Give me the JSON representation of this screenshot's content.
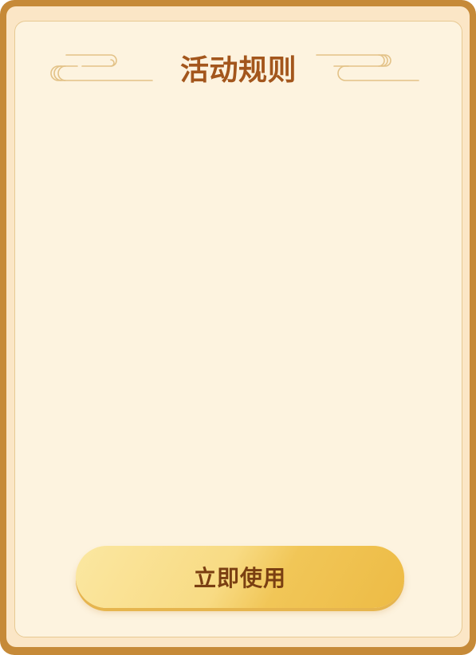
{
  "dialog": {
    "title": "活动规则",
    "rules_text": "",
    "primary_button_label": "立即使用"
  },
  "colors": {
    "frame": "#c68a38",
    "panel_background": "#fdf3df",
    "title": "#a3561c",
    "button_gradient_start": "#fbe7a1",
    "button_gradient_end": "#edbb45",
    "button_text": "#7a3f12"
  },
  "icons": {
    "left_decoration": "cloud-swirl-icon",
    "right_decoration": "cloud-swirl-icon"
  }
}
